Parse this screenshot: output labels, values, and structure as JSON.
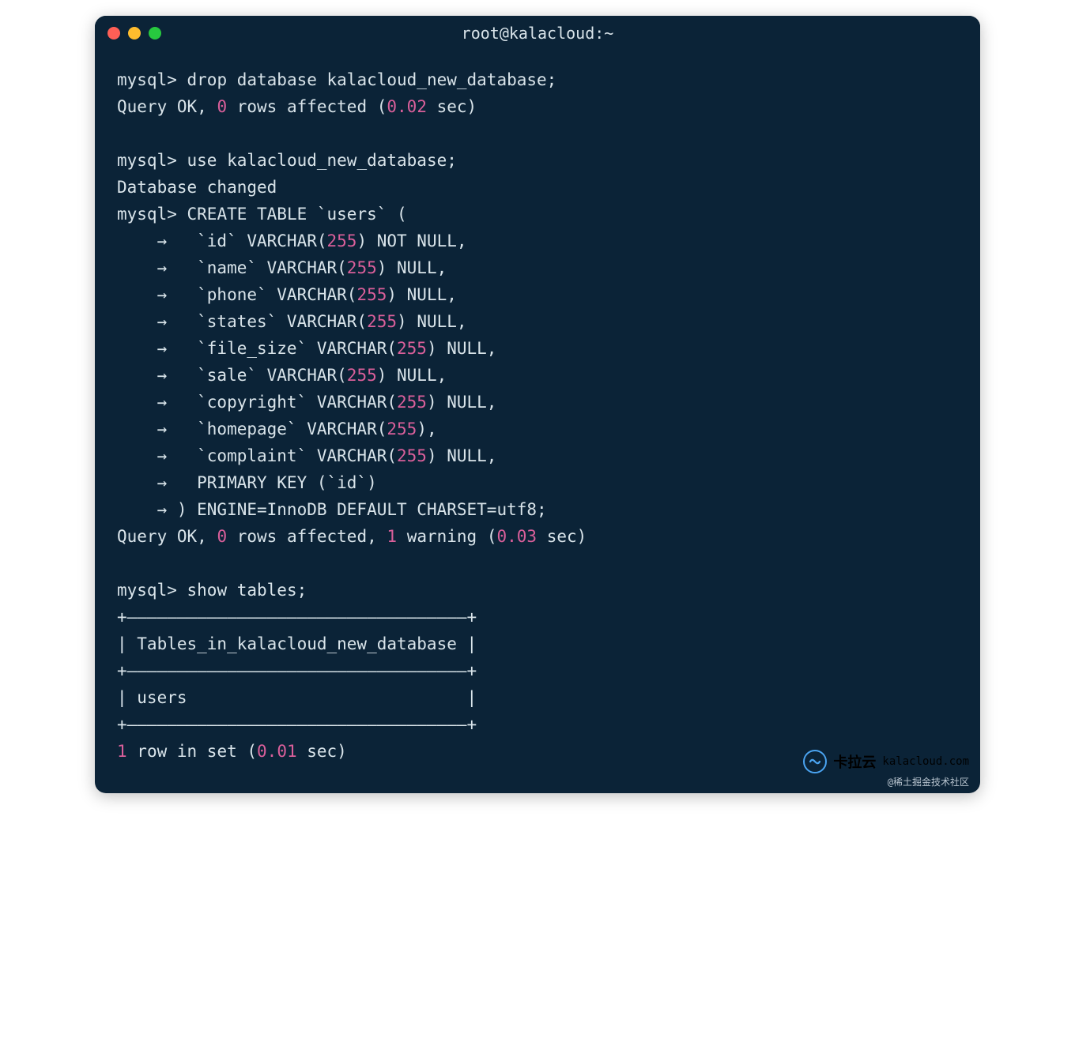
{
  "title": "root@kalacloud:~",
  "colors": {
    "bg": "#0b2337",
    "text": "#d9e4ea",
    "number": "#d95f9a",
    "red": "#ff5f56",
    "yellow": "#ffbd2e",
    "green": "#27c93f"
  },
  "session": {
    "prompt": "mysql>",
    "cont": "    →",
    "commands": [
      {
        "input": "drop database kalacloud_new_database;",
        "output": [
          {
            "type": "queryok",
            "rows": "0",
            "warnings": null,
            "time": "0.02"
          }
        ]
      },
      {
        "blank": true
      },
      {
        "input": "use kalacloud_new_database;",
        "output": [
          {
            "type": "plain",
            "text": "Database changed"
          }
        ]
      },
      {
        "input": "CREATE TABLE `users` (",
        "continuation": [
          {
            "pre": "  `id` VARCHAR(",
            "num": "255",
            "post": ") NOT NULL,"
          },
          {
            "pre": "  `name` VARCHAR(",
            "num": "255",
            "post": ") NULL,"
          },
          {
            "pre": "  `phone` VARCHAR(",
            "num": "255",
            "post": ") NULL,"
          },
          {
            "pre": "  `states` VARCHAR(",
            "num": "255",
            "post": ") NULL,"
          },
          {
            "pre": "  `file_size` VARCHAR(",
            "num": "255",
            "post": ") NULL,"
          },
          {
            "pre": "  `sale` VARCHAR(",
            "num": "255",
            "post": ") NULL,"
          },
          {
            "pre": "  `copyright` VARCHAR(",
            "num": "255",
            "post": ") NULL,"
          },
          {
            "pre": "  `homepage` VARCHAR(",
            "num": "255",
            "post": "),"
          },
          {
            "pre": "  `complaint` VARCHAR(",
            "num": "255",
            "post": ") NULL,"
          },
          {
            "pre": "  PRIMARY KEY (`id`)",
            "num": null,
            "post": ""
          },
          {
            "final": ") ENGINE=InnoDB DEFAULT CHARSET=utf8;"
          }
        ],
        "output": [
          {
            "type": "queryok",
            "rows": "0",
            "warnings": "1",
            "time": "0.03"
          }
        ]
      },
      {
        "blank": true
      },
      {
        "input": "show tables;",
        "output": [
          {
            "type": "table",
            "header": "Tables_in_kalacloud_new_database",
            "rows": [
              "users"
            ],
            "summaryCount": "1",
            "summaryTime": "0.01"
          }
        ]
      }
    ]
  },
  "watermark": {
    "brand_cn": "卡拉云",
    "brand_en": "kalacloud.com",
    "sub": "@稀土掘金技术社区"
  }
}
